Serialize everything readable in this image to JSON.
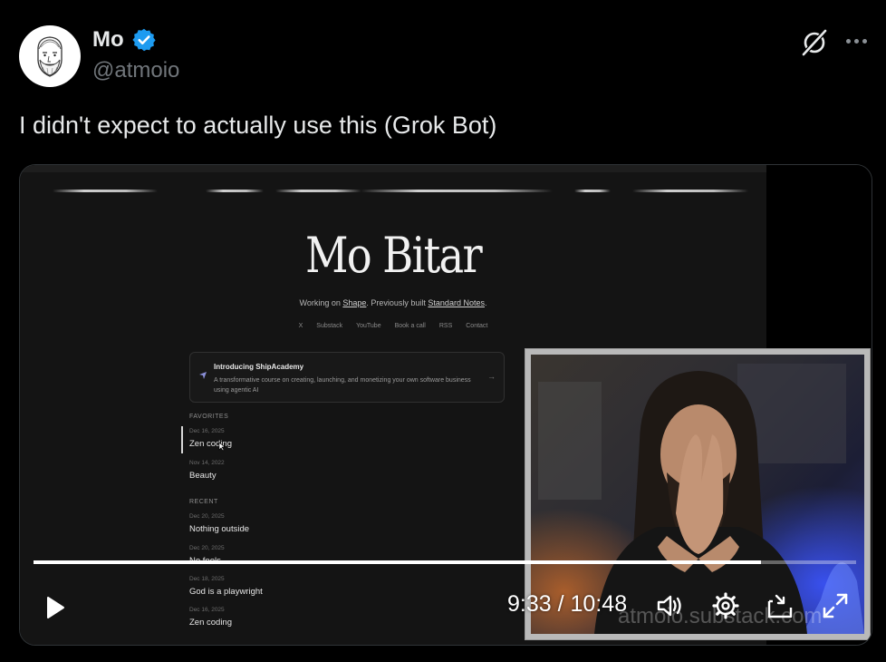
{
  "author": {
    "display_name": "Mo",
    "handle": "@atmoio",
    "verified": true
  },
  "icons": {
    "verified": "verified-badge-icon",
    "grok": "grok-icon",
    "more": "more-icon",
    "play": "play-icon",
    "volume": "volume-icon",
    "settings": "gear-icon",
    "pip": "picture-in-picture-icon",
    "fullscreen": "fullscreen-icon"
  },
  "tweet": {
    "text": "I didn't expect to actually use this (Grok Bot)"
  },
  "video": {
    "current_time": "9:33",
    "separator": "/",
    "duration": "10:48",
    "progress_fraction": 0.884,
    "watermark": "atmoio.substack.com"
  },
  "website": {
    "title": "Mo Bitar",
    "subtitle_prefix": "Working on ",
    "subtitle_link1": "Shape",
    "subtitle_middle": ". Previously built ",
    "subtitle_link2": "Standard Notes",
    "subtitle_suffix": ".",
    "nav": [
      "X",
      "Substack",
      "YouTube",
      "Book a call",
      "RSS",
      "Contact"
    ],
    "promo": {
      "title": "Introducing ShipAcademy",
      "description": "A transformative course on creating, launching, and monetizing your own software business using agentic AI"
    },
    "favorites_label": "FAVORITES",
    "favorites": [
      {
        "date": "Dec 16, 2025",
        "title": "Zen coding"
      },
      {
        "date": "Nov 14, 2022",
        "title": "Beauty"
      }
    ],
    "recent_label": "RECENT",
    "recent": [
      {
        "date": "Dec 20, 2025",
        "title": "Nothing outside"
      },
      {
        "date": "Dec 20, 2025",
        "title": "No fools"
      },
      {
        "date": "Dec 18, 2025",
        "title": "God is a playwright"
      },
      {
        "date": "Dec 16, 2025",
        "title": "Zen coding"
      }
    ]
  },
  "colors": {
    "accent_blue": "#1d9bf0",
    "text_primary": "#e7e9ea",
    "text_secondary": "#71767b"
  }
}
